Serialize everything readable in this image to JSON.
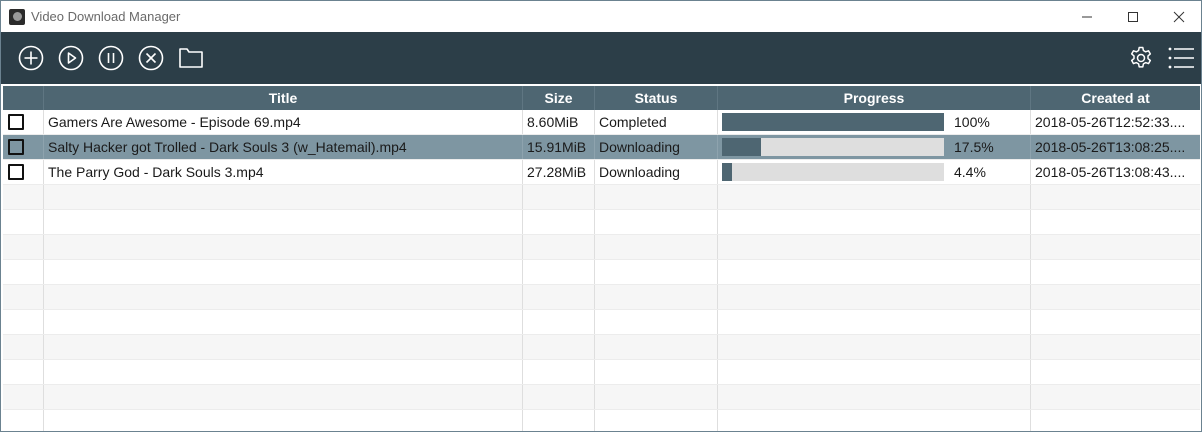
{
  "window": {
    "title": "Video Download Manager"
  },
  "toolbar": {
    "icons": [
      "add-icon",
      "play-icon",
      "pause-icon",
      "cancel-icon",
      "folder-icon",
      "settings-icon",
      "menu-icon"
    ],
    "accent": "#2c3e48"
  },
  "table": {
    "headers": {
      "title": "Title",
      "size": "Size",
      "status": "Status",
      "progress": "Progress",
      "created": "Created at"
    },
    "rows": [
      {
        "title": "Gamers Are Awesome - Episode 69.mp4",
        "size": "8.60MiB",
        "status": "Completed",
        "progress": 1.0,
        "progress_text": "100%",
        "created": "2018-05-26T12:52:33...."
      },
      {
        "title": "Salty Hacker got Trolled - Dark Souls 3 (w_Hatemail).mp4",
        "size": "15.91MiB",
        "status": "Downloading",
        "progress": 0.175,
        "progress_text": "17.5%",
        "created": "2018-05-26T13:08:25...."
      },
      {
        "title": "The Parry God - Dark Souls 3.mp4",
        "size": "27.28MiB",
        "status": "Downloading",
        "progress": 0.044,
        "progress_text": "4.4%",
        "created": "2018-05-26T13:08:43...."
      }
    ],
    "selected_row": 1,
    "header_color": "#4e6672",
    "selected_color": "#7e96a2"
  }
}
